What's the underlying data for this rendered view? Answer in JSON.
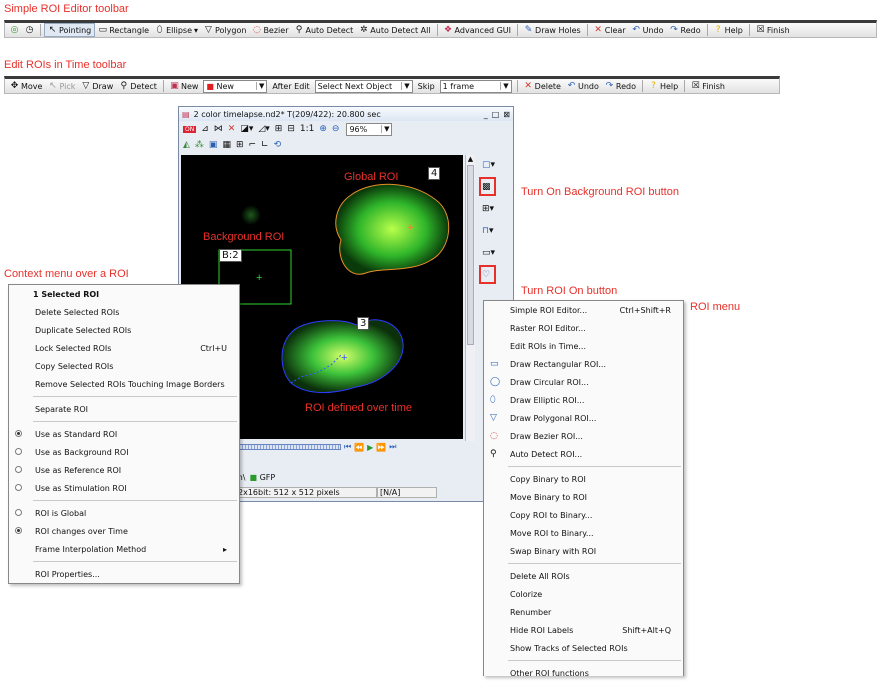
{
  "captions": {
    "simple_toolbar": "Simple ROI Editor toolbar",
    "time_toolbar": "Edit ROIs in Time toolbar",
    "background_btn": "Turn On Background ROI button",
    "roi_on_btn": "Turn ROI On button",
    "roi_menu": "ROI menu",
    "context_menu": "Context menu over a ROI"
  },
  "simple_toolbar": {
    "items": [
      "Pointing",
      "Rectangle",
      "Ellipse",
      "Polygon",
      "Bezier",
      "Auto Detect",
      "Auto Detect All",
      "Advanced GUI",
      "Draw Holes",
      "Clear",
      "Undo",
      "Redo",
      "Help",
      "Finish"
    ]
  },
  "time_toolbar": {
    "move": "Move",
    "pick": "Pick",
    "draw": "Draw",
    "detect": "Detect",
    "new_btn": "New",
    "new_combo": "New",
    "after_edit_label": "After Edit",
    "after_edit_value": "Select Next Object",
    "skip_label": "Skip",
    "skip_value": "1 frame",
    "delete": "Delete",
    "undo": "Undo",
    "redo": "Redo",
    "help": "Help",
    "finish": "Finish"
  },
  "window": {
    "title": "2 color timelapse.nd2*  T(209/422): 20.800 sec",
    "zoom_ratio": "1:1",
    "zoom": "96%",
    "roi_labels": {
      "global": "4",
      "background": "B:2",
      "time": "3"
    },
    "overlay_labels": {
      "global": "Global ROI",
      "background": "Background ROI",
      "time": "ROI defined over time"
    },
    "channel_tabs": [
      "m\\",
      "GFP"
    ],
    "status": {
      "bits": "2x16bit: 512 x 512 pixels",
      "value": "[N/A]"
    }
  },
  "context_menu": {
    "header": "1 Selected ROI",
    "items": [
      "Delete Selected ROIs",
      "Duplicate Selected ROIs",
      "Lock Selected ROIs",
      "Copy Selected ROIs",
      "Remove Selected ROIs Touching Image Borders",
      "Separate ROI",
      "Use as Standard ROI",
      "Use as Background ROI",
      "Use as Reference ROI",
      "Use as Stimulation ROI",
      "ROI is Global",
      "ROI changes over Time",
      "Frame Interpolation Method",
      "ROI Properties..."
    ],
    "lock_shortcut": "Ctrl+U"
  },
  "roi_menu": {
    "items": [
      "Simple ROI Editor...",
      "Raster ROI Editor...",
      "Edit ROIs in Time...",
      "Draw Rectangular ROI...",
      "Draw Circular ROI...",
      "Draw Elliptic ROI...",
      "Draw Polygonal ROI...",
      "Draw Bezier ROI...",
      "Auto Detect ROI...",
      "Copy Binary to ROI",
      "Move Binary to ROI",
      "Copy ROI to Binary...",
      "Move ROI to Binary...",
      "Swap Binary with ROI",
      "Delete All ROIs",
      "Colorize",
      "Renumber",
      "Hide ROI Labels",
      "Show Tracks of Selected ROIs",
      "Other ROI functions"
    ],
    "shortcuts": {
      "simple": "Ctrl+Shift+R",
      "hide": "Shift+Alt+Q"
    }
  },
  "colors": {
    "annotation": "#e8302a",
    "roi_global": "#e8902a",
    "roi_background": "#2fd42f",
    "roi_time": "#3355ff"
  }
}
